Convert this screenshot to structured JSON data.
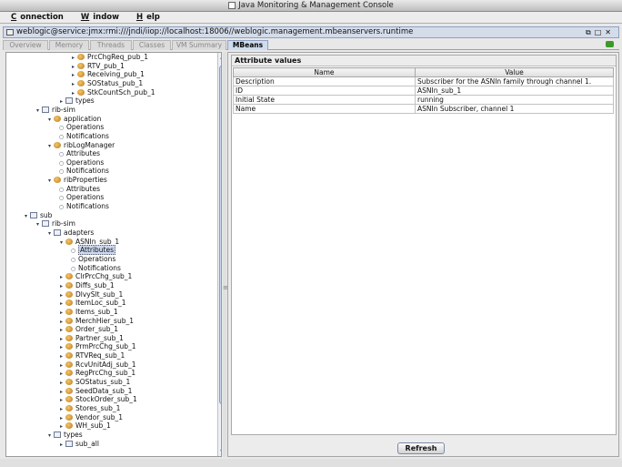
{
  "window": {
    "title": "Java Monitoring & Management Console"
  },
  "menubar": {
    "items": [
      "Connection",
      "Window",
      "Help"
    ]
  },
  "document": {
    "title": "weblogic@service:jmx:rmi:///jndi/iiop://localhost:18006//weblogic.management.mbeanservers.runtime"
  },
  "tabs": [
    "Overview",
    "Memory",
    "Threads",
    "Classes",
    "VM Summary",
    "MBeans"
  ],
  "active_tab": "MBeans",
  "tree": {
    "items": [
      {
        "label": "PrcChgReq_pub_1",
        "depth": 5,
        "kind": "bean",
        "expander": "closed"
      },
      {
        "label": "RTV_pub_1",
        "depth": 5,
        "kind": "bean",
        "expander": "closed"
      },
      {
        "label": "Receiving_pub_1",
        "depth": 5,
        "kind": "bean",
        "expander": "closed"
      },
      {
        "label": "SOStatus_pub_1",
        "depth": 5,
        "kind": "bean",
        "expander": "closed"
      },
      {
        "label": "StkCountSch_pub_1",
        "depth": 5,
        "kind": "bean",
        "expander": "closed"
      },
      {
        "label": "types",
        "depth": 4,
        "kind": "folder",
        "expander": "closed"
      },
      {
        "label": "rib-sim",
        "depth": 2,
        "kind": "folder",
        "expander": "open"
      },
      {
        "label": "application",
        "depth": 3,
        "kind": "bean",
        "expander": "open"
      },
      {
        "label": "Operations",
        "depth": 4,
        "kind": "leaf",
        "expander": ""
      },
      {
        "label": "Notifications",
        "depth": 4,
        "kind": "leaf",
        "expander": ""
      },
      {
        "label": "ribLogManager",
        "depth": 3,
        "kind": "bean",
        "expander": "open"
      },
      {
        "label": "Attributes",
        "depth": 4,
        "kind": "leaf",
        "expander": ""
      },
      {
        "label": "Operations",
        "depth": 4,
        "kind": "leaf",
        "expander": ""
      },
      {
        "label": "Notifications",
        "depth": 4,
        "kind": "leaf",
        "expander": ""
      },
      {
        "label": "ribProperties",
        "depth": 3,
        "kind": "bean",
        "expander": "open"
      },
      {
        "label": "Attributes",
        "depth": 4,
        "kind": "leaf",
        "expander": ""
      },
      {
        "label": "Operations",
        "depth": 4,
        "kind": "leaf",
        "expander": ""
      },
      {
        "label": "Notifications",
        "depth": 4,
        "kind": "leaf",
        "expander": ""
      },
      {
        "label": "sub",
        "depth": 1,
        "kind": "folder",
        "expander": "open"
      },
      {
        "label": "rib-sim",
        "depth": 2,
        "kind": "folder",
        "expander": "open"
      },
      {
        "label": "adapters",
        "depth": 3,
        "kind": "folder",
        "expander": "open"
      },
      {
        "label": "ASNIn_sub_1",
        "depth": 4,
        "kind": "bean",
        "expander": "open"
      },
      {
        "label": "Attributes",
        "depth": 5,
        "kind": "leaf",
        "expander": "",
        "selected": true
      },
      {
        "label": "Operations",
        "depth": 5,
        "kind": "leaf",
        "expander": ""
      },
      {
        "label": "Notifications",
        "depth": 5,
        "kind": "leaf",
        "expander": ""
      },
      {
        "label": "ClrPrcChg_sub_1",
        "depth": 4,
        "kind": "bean",
        "expander": "closed"
      },
      {
        "label": "Diffs_sub_1",
        "depth": 4,
        "kind": "bean",
        "expander": "closed"
      },
      {
        "label": "DlvySlt_sub_1",
        "depth": 4,
        "kind": "bean",
        "expander": "closed"
      },
      {
        "label": "ItemLoc_sub_1",
        "depth": 4,
        "kind": "bean",
        "expander": "closed"
      },
      {
        "label": "Items_sub_1",
        "depth": 4,
        "kind": "bean",
        "expander": "closed"
      },
      {
        "label": "MerchHier_sub_1",
        "depth": 4,
        "kind": "bean",
        "expander": "closed"
      },
      {
        "label": "Order_sub_1",
        "depth": 4,
        "kind": "bean",
        "expander": "closed"
      },
      {
        "label": "Partner_sub_1",
        "depth": 4,
        "kind": "bean",
        "expander": "closed"
      },
      {
        "label": "PrmPrcChg_sub_1",
        "depth": 4,
        "kind": "bean",
        "expander": "closed"
      },
      {
        "label": "RTVReq_sub_1",
        "depth": 4,
        "kind": "bean",
        "expander": "closed"
      },
      {
        "label": "RcvUnitAdj_sub_1",
        "depth": 4,
        "kind": "bean",
        "expander": "closed"
      },
      {
        "label": "RegPrcChg_sub_1",
        "depth": 4,
        "kind": "bean",
        "expander": "closed"
      },
      {
        "label": "SOStatus_sub_1",
        "depth": 4,
        "kind": "bean",
        "expander": "closed"
      },
      {
        "label": "SeedData_sub_1",
        "depth": 4,
        "kind": "bean",
        "expander": "closed"
      },
      {
        "label": "StockOrder_sub_1",
        "depth": 4,
        "kind": "bean",
        "expander": "closed"
      },
      {
        "label": "Stores_sub_1",
        "depth": 4,
        "kind": "bean",
        "expander": "closed"
      },
      {
        "label": "Vendor_sub_1",
        "depth": 4,
        "kind": "bean",
        "expander": "closed"
      },
      {
        "label": "WH_sub_1",
        "depth": 4,
        "kind": "bean",
        "expander": "closed"
      },
      {
        "label": "types",
        "depth": 3,
        "kind": "folder",
        "expander": "open"
      },
      {
        "label": "sub_all",
        "depth": 4,
        "kind": "folder",
        "expander": "closed"
      }
    ]
  },
  "attributes_panel": {
    "title": "Attribute values",
    "columns": [
      "Name",
      "Value"
    ],
    "rows": [
      {
        "name": "Description",
        "value": "Subscriber for the ASNIn family through channel 1."
      },
      {
        "name": "ID",
        "value": "ASNIn_sub_1"
      },
      {
        "name": "Initial State",
        "value": "running"
      },
      {
        "name": "Name",
        "value": "ASNIn Subscriber, channel 1"
      }
    ],
    "refresh_label": "Refresh"
  }
}
